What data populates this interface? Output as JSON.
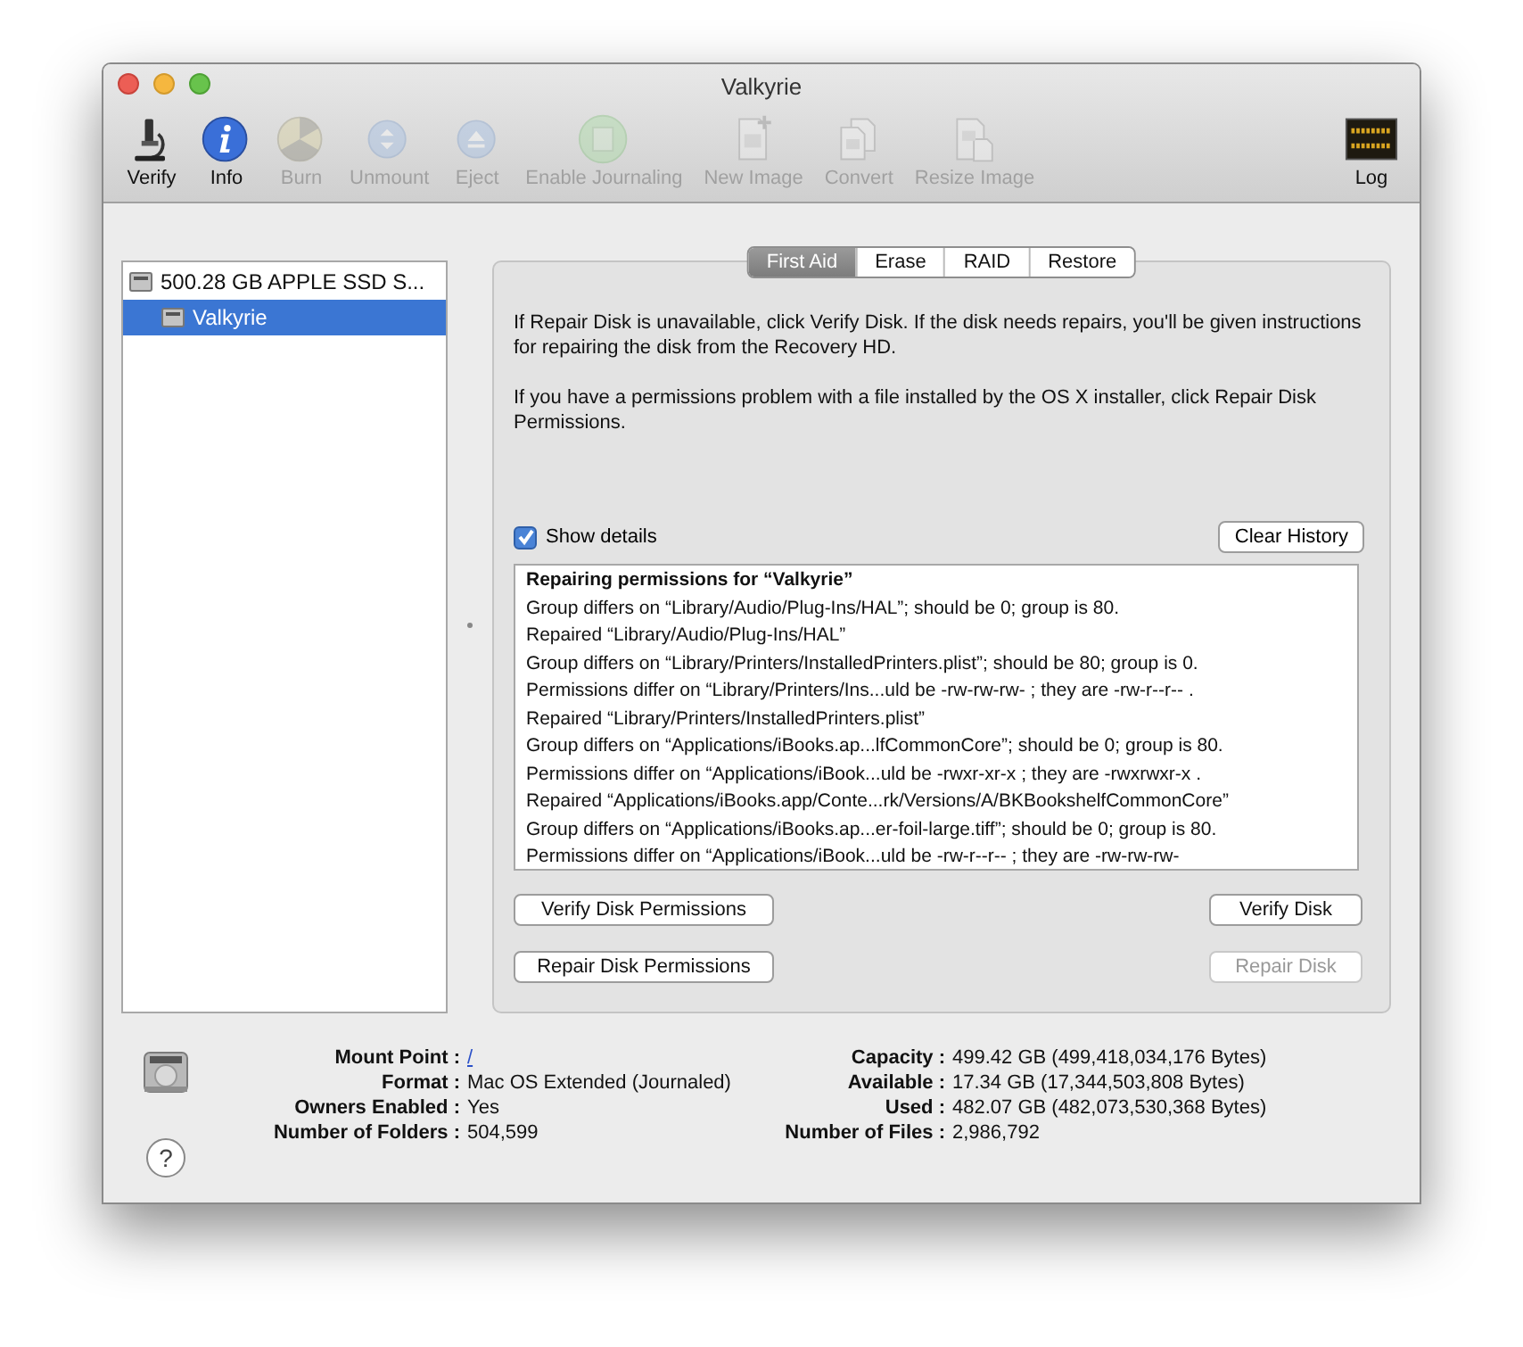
{
  "window": {
    "title": "Valkyrie"
  },
  "toolbar": [
    {
      "label": "Verify",
      "kind": "microscope",
      "disabled": false
    },
    {
      "label": "Info",
      "kind": "info",
      "disabled": false
    },
    {
      "label": "Burn",
      "kind": "burn",
      "disabled": true
    },
    {
      "label": "Unmount",
      "kind": "unmount",
      "disabled": true
    },
    {
      "label": "Eject",
      "kind": "eject",
      "disabled": true
    },
    {
      "label": "Enable Journaling",
      "kind": "journal",
      "disabled": true
    },
    {
      "label": "New Image",
      "kind": "newimage",
      "disabled": true
    },
    {
      "label": "Convert",
      "kind": "convert",
      "disabled": true
    },
    {
      "label": "Resize Image",
      "kind": "resize",
      "disabled": true
    },
    {
      "label": "Log",
      "kind": "log",
      "disabled": false
    }
  ],
  "sidebar": {
    "items": [
      {
        "label": "500.28 GB APPLE SSD S...",
        "selected": false,
        "children": [
          {
            "label": "Valkyrie",
            "selected": true
          }
        ]
      }
    ]
  },
  "tabs": [
    {
      "label": "First Aid",
      "selected": true
    },
    {
      "label": "Erase",
      "selected": false
    },
    {
      "label": "RAID",
      "selected": false
    },
    {
      "label": "Restore",
      "selected": false
    }
  ],
  "instructions": [
    "If Repair Disk is unavailable, click Verify Disk. If the disk needs repairs, you'll be given instructions for repairing the disk from the Recovery HD.",
    "If you have a permissions problem with a file installed by the OS X installer, click Repair Disk Permissions."
  ],
  "show_details": {
    "label": "Show details",
    "checked": true
  },
  "clear_history": {
    "label": "Clear History",
    "disabled": false
  },
  "log": {
    "heading": "Repairing permissions for “Valkyrie”",
    "lines": [
      "Group differs on “Library/Audio/Plug-Ins/HAL”; should be 0; group is 80.",
      "Repaired “Library/Audio/Plug-Ins/HAL”",
      "Group differs on “Library/Printers/InstalledPrinters.plist”; should be 80; group is 0.",
      "Permissions differ on “Library/Printers/Ins...uld be -rw-rw-rw- ; they are -rw-r--r-- .",
      "Repaired “Library/Printers/InstalledPrinters.plist”",
      "Group differs on “Applications/iBooks.ap...lfCommonCore”; should be 0; group is 80.",
      "Permissions differ on “Applications/iBook...uld be -rwxr-xr-x ; they are -rwxrwxr-x .",
      "Repaired “Applications/iBooks.app/Conte...rk/Versions/A/BKBookshelfCommonCore”",
      "Group differs on “Applications/iBooks.ap...er-foil-large.tiff”; should be 0; group is 80.",
      "Permissions differ on “Applications/iBook...uld be -rw-r--r-- ; they are -rw-rw-rw-"
    ]
  },
  "buttons": [
    [
      {
        "label": "Verify Disk Permissions",
        "disabled": false
      },
      {
        "label": "Verify Disk",
        "disabled": false
      }
    ],
    [
      {
        "label": "Repair Disk Permissions",
        "disabled": false
      },
      {
        "label": "Repair Disk",
        "disabled": true
      }
    ]
  ],
  "info": {
    "left": [
      {
        "label": "Mount Point :",
        "value": "/",
        "link": true
      },
      {
        "label": "Format :",
        "value": "Mac OS Extended (Journaled)",
        "link": false
      },
      {
        "label": "Owners Enabled :",
        "value": "Yes",
        "link": false
      },
      {
        "label": "Number of Folders :",
        "value": "504,599",
        "link": false
      }
    ],
    "right": [
      {
        "label": "Capacity :",
        "value": "499.42 GB (499,418,034,176 Bytes)",
        "link": false
      },
      {
        "label": "Available :",
        "value": "17.34 GB (17,344,503,808 Bytes)",
        "link": false
      },
      {
        "label": "Used :",
        "value": "482.07 GB (482,073,530,368 Bytes)",
        "link": false
      },
      {
        "label": "Number of Files :",
        "value": "2,986,792",
        "link": false
      }
    ]
  },
  "help": {
    "label": "?"
  }
}
